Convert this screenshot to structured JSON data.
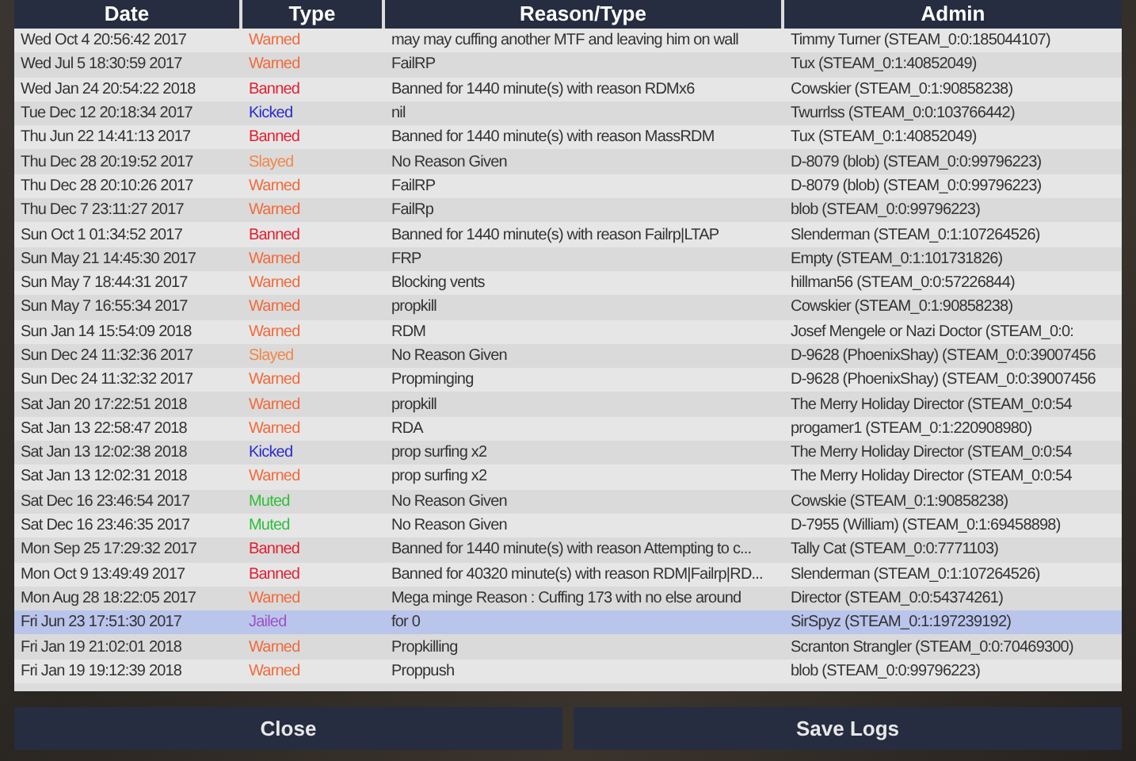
{
  "table": {
    "columns": [
      "Date",
      "Type",
      "Reason/Type",
      "Admin"
    ],
    "rows": [
      {
        "date": "Wed Oct  4 20:56:42 2017",
        "type": "Warned",
        "color": "#f26a3a",
        "reason": "may may cuffing another MTF and leaving him on wall",
        "admin": "Timmy Turner (STEAM_0:0:185044107)",
        "selected": false
      },
      {
        "date": "Wed Jul  5 18:30:59 2017",
        "type": "Warned",
        "color": "#f26a3a",
        "reason": "FailRP",
        "admin": "Tux (STEAM_0:1:40852049)",
        "selected": false
      },
      {
        "date": "Wed Jan 24 20:54:22 2018",
        "type": "Banned",
        "color": "#e02030",
        "reason": "Banned for 1440 minute(s) with reason RDMx6",
        "admin": "Cowskier (STEAM_0:1:90858238)",
        "selected": false
      },
      {
        "date": "Tue Dec 12 20:18:34 2017",
        "type": "Kicked",
        "color": "#2a2ad0",
        "reason": "nil",
        "admin": "Twurrlss (STEAM_0:0:103766442)",
        "selected": false
      },
      {
        "date": "Thu Jun 22 14:41:13 2017",
        "type": "Banned",
        "color": "#e02030",
        "reason": "Banned for 1440 minute(s) with reason MassRDM",
        "admin": "Tux (STEAM_0:1:40852049)",
        "selected": false
      },
      {
        "date": "Thu Dec 28 20:19:52 2017",
        "type": "Slayed",
        "color": "#f0884a",
        "reason": "No Reason Given",
        "admin": "D-8079 (blob) (STEAM_0:0:99796223)",
        "selected": false
      },
      {
        "date": "Thu Dec 28 20:10:26 2017",
        "type": "Warned",
        "color": "#f26a3a",
        "reason": "FailRP",
        "admin": "D-8079 (blob) (STEAM_0:0:99796223)",
        "selected": false
      },
      {
        "date": "Thu Dec  7 23:11:27 2017",
        "type": "Warned",
        "color": "#f26a3a",
        "reason": "FailRp",
        "admin": "blob (STEAM_0:0:99796223)",
        "selected": false
      },
      {
        "date": "Sun Oct  1 01:34:52 2017",
        "type": "Banned",
        "color": "#e02030",
        "reason": "Banned for 1440 minute(s) with reason Failrp|LTAP",
        "admin": "Slenderman (STEAM_0:1:107264526)",
        "selected": false
      },
      {
        "date": "Sun May 21 14:45:30 2017",
        "type": "Warned",
        "color": "#f26a3a",
        "reason": "FRP",
        "admin": "Empty (STEAM_0:1:101731826)",
        "selected": false
      },
      {
        "date": "Sun May  7 18:44:31 2017",
        "type": "Warned",
        "color": "#f26a3a",
        "reason": "Blocking vents",
        "admin": "hillman56 (STEAM_0:0:57226844)",
        "selected": false
      },
      {
        "date": "Sun May  7 16:55:34 2017",
        "type": "Warned",
        "color": "#f26a3a",
        "reason": "propkill",
        "admin": "Cowskier (STEAM_0:1:90858238)",
        "selected": false
      },
      {
        "date": "Sun Jan 14 15:54:09 2018",
        "type": "Warned",
        "color": "#f26a3a",
        "reason": "RDM",
        "admin": "Josef Mengele or Nazi Doctor (STEAM_0:0:",
        "selected": false
      },
      {
        "date": "Sun Dec 24 11:32:36 2017",
        "type": "Slayed",
        "color": "#f0884a",
        "reason": "No Reason Given",
        "admin": "D-9628 (PhoenixShay) (STEAM_0:0:39007456",
        "selected": false
      },
      {
        "date": "Sun Dec 24 11:32:32 2017",
        "type": "Warned",
        "color": "#f26a3a",
        "reason": "Propminging",
        "admin": "D-9628 (PhoenixShay) (STEAM_0:0:39007456",
        "selected": false
      },
      {
        "date": "Sat Jan 20 17:22:51 2018",
        "type": "Warned",
        "color": "#f26a3a",
        "reason": "propkill",
        "admin": "The Merry Holiday Director (STEAM_0:0:54",
        "selected": false
      },
      {
        "date": "Sat Jan 13 22:58:47 2018",
        "type": "Warned",
        "color": "#f26a3a",
        "reason": "RDA",
        "admin": "progamer1 (STEAM_0:1:220908980)",
        "selected": false
      },
      {
        "date": "Sat Jan 13 12:02:38 2018",
        "type": "Kicked",
        "color": "#2a2ad0",
        "reason": "prop surfing x2",
        "admin": "The Merry Holiday Director (STEAM_0:0:54",
        "selected": false
      },
      {
        "date": "Sat Jan 13 12:02:31 2018",
        "type": "Warned",
        "color": "#f26a3a",
        "reason": "prop surfing x2",
        "admin": "The Merry Holiday Director (STEAM_0:0:54",
        "selected": false
      },
      {
        "date": "Sat Dec 16 23:46:54 2017",
        "type": "Muted",
        "color": "#2ebf3a",
        "reason": "No Reason Given",
        "admin": "Cowskie (STEAM_0:1:90858238)",
        "selected": false
      },
      {
        "date": "Sat Dec 16 23:46:35 2017",
        "type": "Muted",
        "color": "#2ebf3a",
        "reason": "No Reason Given",
        "admin": "D-7955 (William) (STEAM_0:1:69458898)",
        "selected": false
      },
      {
        "date": "Mon Sep 25 17:29:32 2017",
        "type": "Banned",
        "color": "#e02030",
        "reason": "Banned for 1440 minute(s) with reason Attempting to c...",
        "admin": "Tally Cat (STEAM_0:0:7771103)",
        "selected": false
      },
      {
        "date": "Mon Oct  9 13:49:49 2017",
        "type": "Banned",
        "color": "#e02030",
        "reason": "Banned for 40320 minute(s) with reason RDM|Failrp|RD...",
        "admin": "Slenderman (STEAM_0:1:107264526)",
        "selected": false
      },
      {
        "date": "Mon Aug 28 18:22:05 2017",
        "type": "Warned",
        "color": "#f26a3a",
        "reason": "Mega minge Reason : Cuffing 173 with no else around",
        "admin": "Director (STEAM_0:0:54374261)",
        "selected": false
      },
      {
        "date": "Fri Jun 23 17:51:30 2017",
        "type": "Jailed",
        "color": "#a050c8",
        "reason": "for 0",
        "admin": "SirSpyz (STEAM_0:1:197239192)",
        "selected": true
      },
      {
        "date": "Fri Jan 19 21:02:01 2018",
        "type": "Warned",
        "color": "#f26a3a",
        "reason": "Propkilling",
        "admin": "Scranton Strangler (STEAM_0:0:70469300)",
        "selected": false
      },
      {
        "date": "Fri Jan 19 19:12:39 2018",
        "type": "Warned",
        "color": "#f26a3a",
        "reason": "Proppush",
        "admin": "blob (STEAM_0:0:99796223)",
        "selected": false
      }
    ]
  },
  "buttons": [
    "Close",
    "Save Logs"
  ]
}
